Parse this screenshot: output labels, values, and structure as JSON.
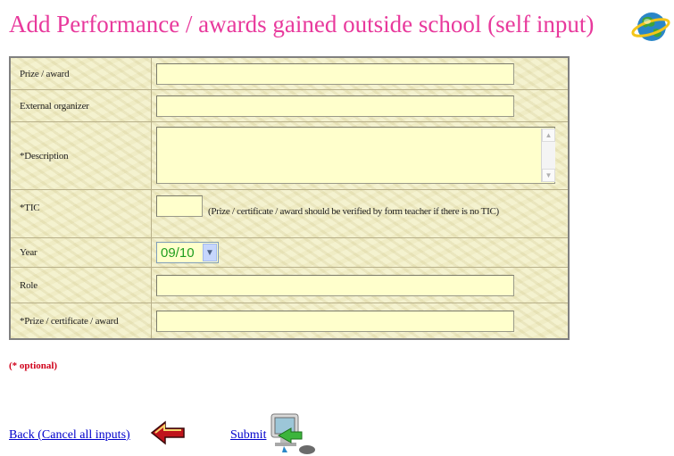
{
  "page": {
    "title": "Add Performance / awards gained outside school (self input)",
    "globe_icon": "globe-icon"
  },
  "form": {
    "prize_award": {
      "label": "Prize / award",
      "value": ""
    },
    "external_organizer": {
      "label": "External organizer",
      "value": ""
    },
    "description": {
      "label": "*Description",
      "value": ""
    },
    "tic": {
      "label": "*TIC",
      "value": "",
      "note": "(Prize / certificate / award should be verified by form teacher if there is no TIC)"
    },
    "year": {
      "label": "Year",
      "selected": "09/10"
    },
    "role": {
      "label": "Role",
      "value": ""
    },
    "prize_certificate_award": {
      "label": "*Prize / certificate / award",
      "value": ""
    }
  },
  "optional_note": "(* optional)",
  "actions": {
    "back_label": "Back (Cancel all inputs)",
    "back_icon": "red-left-arrow-icon",
    "submit_label": "Submit",
    "submit_icon": "computer-icon"
  },
  "colors": {
    "title": "#e8399c",
    "form_background": "#f2efc9",
    "field_background": "#ffffcc",
    "optional_note": "#d0021b",
    "link": "#0000cc"
  }
}
